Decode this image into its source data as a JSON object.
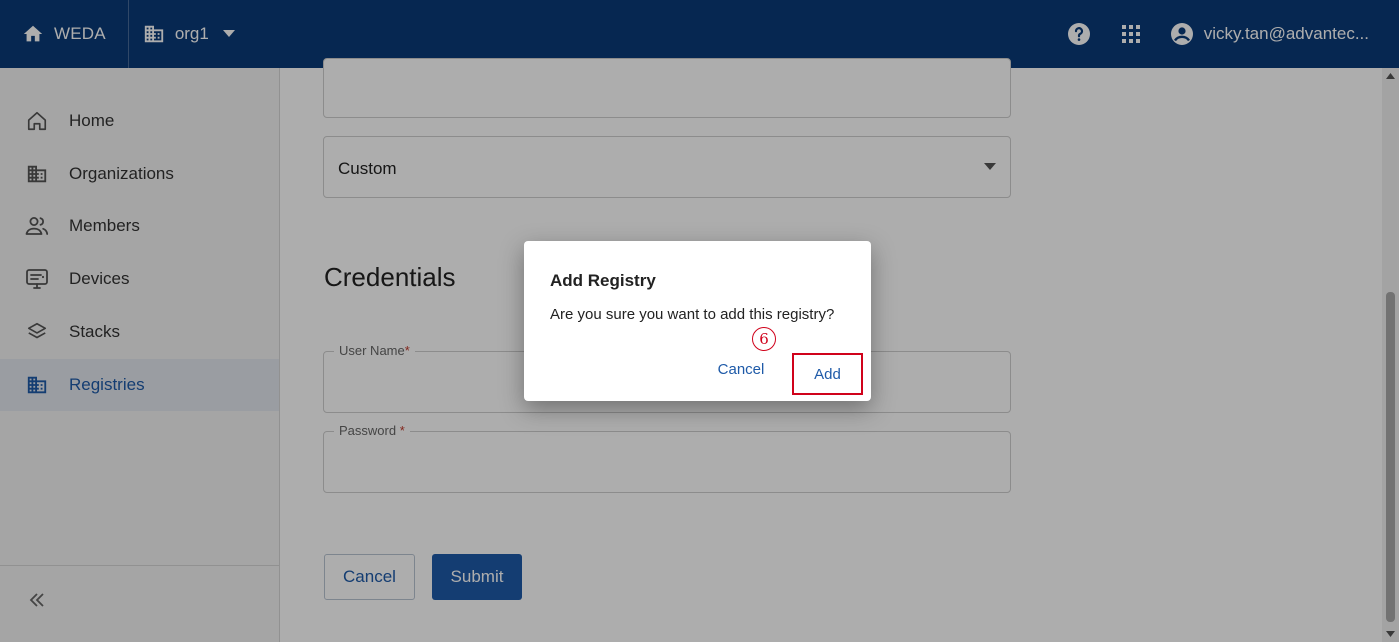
{
  "topbar": {
    "brand": "WEDA",
    "org": "org1",
    "user": "vicky.tan@advantec..."
  },
  "sidebar": {
    "items": [
      {
        "label": "Home",
        "icon": "home-outline-icon"
      },
      {
        "label": "Organizations",
        "icon": "building-icon"
      },
      {
        "label": "Members",
        "icon": "people-icon"
      },
      {
        "label": "Devices",
        "icon": "device-icon"
      },
      {
        "label": "Stacks",
        "icon": "layers-icon"
      },
      {
        "label": "Registries",
        "icon": "building-icon",
        "active": true
      }
    ]
  },
  "form": {
    "type_value": "Custom",
    "credentials_title": "Credentials",
    "username_label": "User Name",
    "password_label": "Password ",
    "required_mark": "*",
    "cancel_label": "Cancel",
    "submit_label": "Submit"
  },
  "dialog": {
    "title": "Add Registry",
    "message": "Are you sure you want to add this registry?",
    "cancel_label": "Cancel",
    "add_label": "Add",
    "step_marker": "6"
  },
  "colors": {
    "topbar": "#0a3a78",
    "accent": "#1e5aa8",
    "highlight": "#d0021b"
  }
}
